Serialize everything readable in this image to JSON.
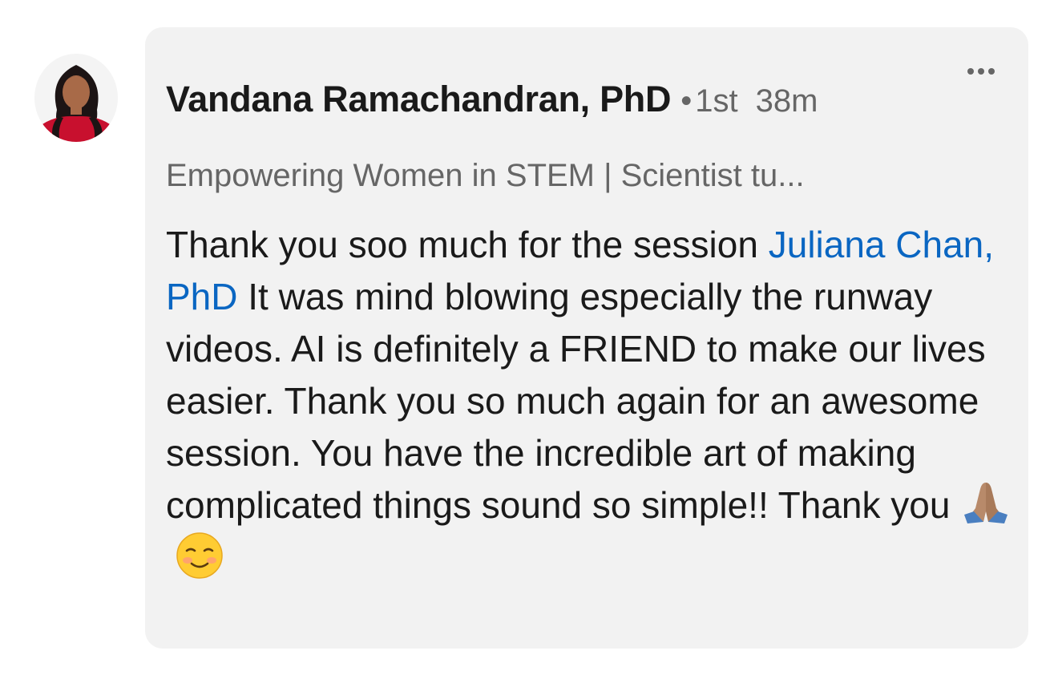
{
  "comment": {
    "author": {
      "name": "Vandana Ramachandran, PhD",
      "separator": "•",
      "degree": "1st",
      "time": "38m",
      "headline": "Empowering Women in STEM | Scientist tu..."
    },
    "text": {
      "before_mention": "Thank you soo much for the session ",
      "mention": "Juliana Chan, PhD",
      "after_mention": " It was mind blowing especially the runway videos. AI is definitely a FRIEND to make our lives easier. Thank you so much again for an awesome session. You have the incredible art of making complicated things sound so simple!! Thank you"
    },
    "emojis": [
      "folded-hands-icon",
      "smiling-face-icon"
    ]
  },
  "colors": {
    "bubble": "#f2f2f2",
    "mention": "#0a66c2",
    "secondary_text": "#666666",
    "primary_text": "#1a1a1a"
  }
}
